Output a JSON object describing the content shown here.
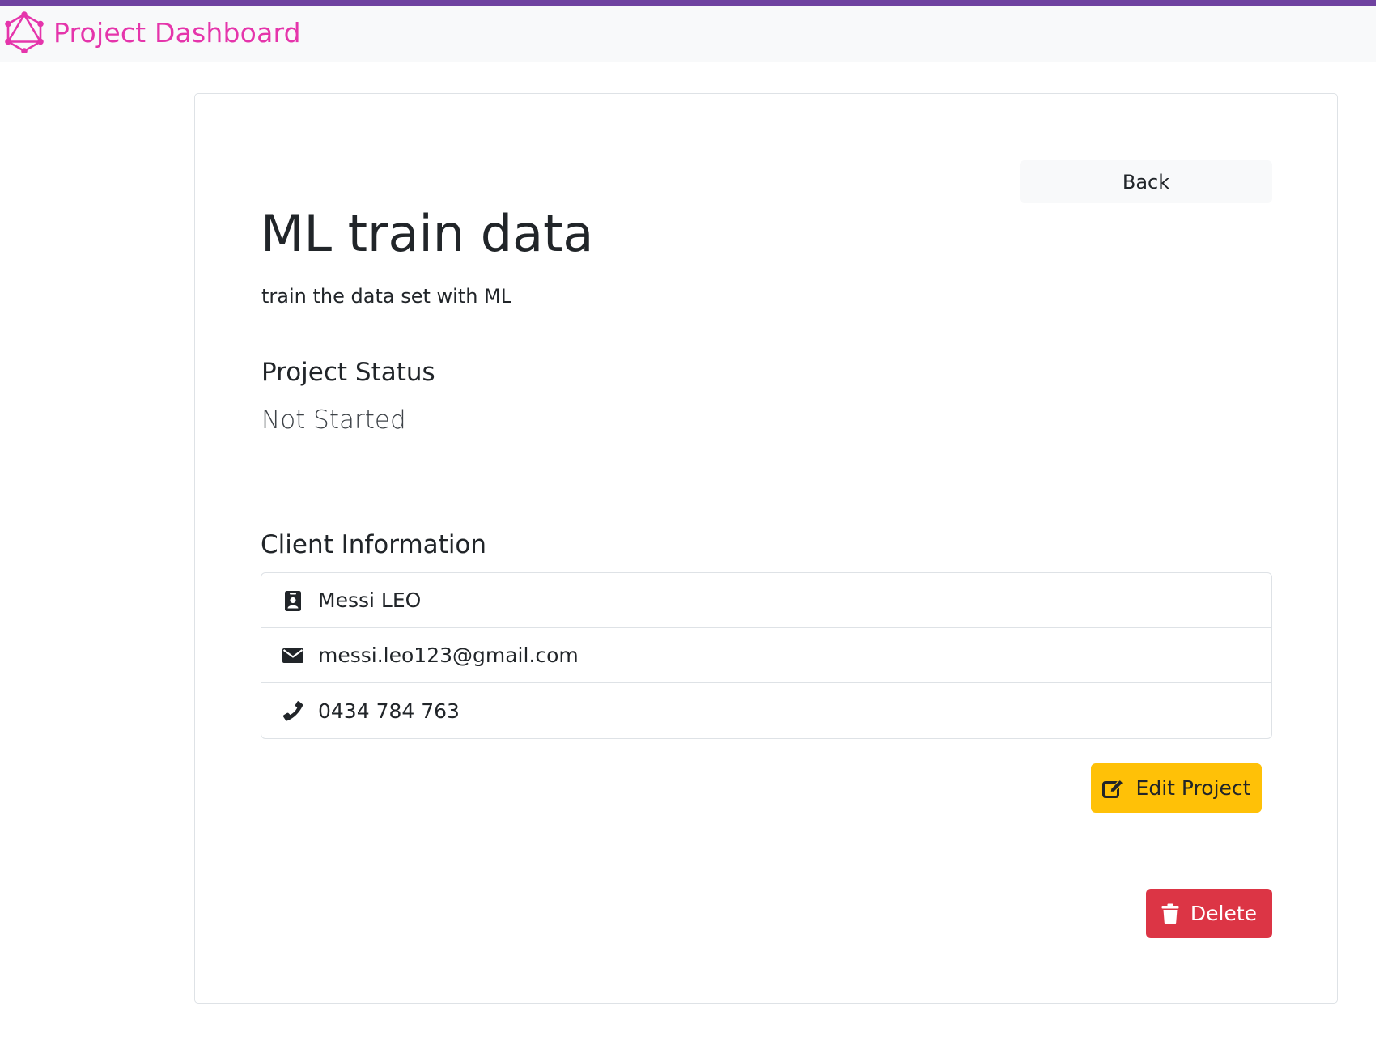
{
  "navbar": {
    "brand_title": "Project Dashboard",
    "brand_color": "#e535ab",
    "accent_border_color": "#6f42a0",
    "logo_icon": "graphql-logo-icon"
  },
  "project": {
    "back_label": "Back",
    "name": "ML train data",
    "description": "train the data set with ML",
    "status_heading": "Project Status",
    "status_value": "Not Started",
    "client_heading": "Client Information",
    "client": [
      {
        "icon": "id-badge-icon",
        "value": "Messi LEO"
      },
      {
        "icon": "envelope-icon",
        "value": "messi.leo123@gmail.com"
      },
      {
        "icon": "phone-icon",
        "value": "0434 784 763"
      }
    ],
    "edit_label": "Edit Project",
    "edit_icon": "edit-icon",
    "edit_color": "#ffc107",
    "delete_label": "Delete",
    "delete_icon": "trash-icon",
    "delete_color": "#dc3545"
  }
}
